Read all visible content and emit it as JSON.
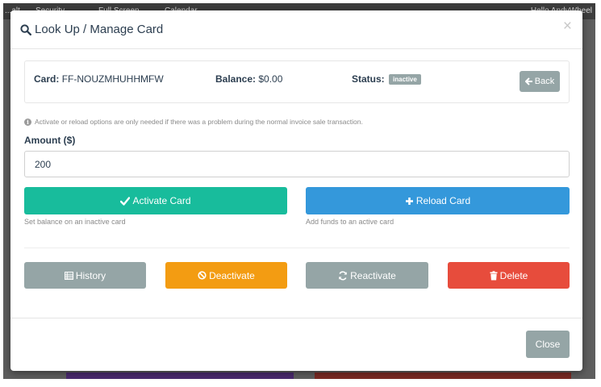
{
  "background": {
    "topbar_items": [
      "...alt",
      "Security",
      "Full Screen",
      "Calendar"
    ],
    "greeting": "Hello AndyWheel"
  },
  "modal": {
    "title": "Look Up / Manage Card",
    "close_glyph": "×",
    "card": {
      "card_label": "Card:",
      "card_value": "FF-NOUZMHUHHMFW",
      "balance_label": "Balance:",
      "balance_value": "$0.00",
      "status_label": "Status:",
      "status_value": "inactive"
    },
    "back_label": "Back",
    "note": "Activate or reload options are only needed if there was a problem during the normal invoice sale transaction.",
    "amount_label": "Amount ($)",
    "amount_value": "200",
    "activate_label": "Activate Card",
    "activate_help": "Set balance on an inactive card",
    "reload_label": "Reload Card",
    "reload_help": "Add funds to an active card",
    "history_label": "History",
    "deactivate_label": "Deactivate",
    "reactivate_label": "Reactivate",
    "delete_label": "Delete",
    "footer_close_label": "Close"
  },
  "icons": {
    "title": "search-icon",
    "back": "arrow-left-icon",
    "note": "info-circle-icon",
    "activate": "check-icon",
    "reload": "plus-icon",
    "history": "list-icon",
    "deactivate": "ban-icon",
    "reactivate": "refresh-icon",
    "delete": "trash-icon"
  },
  "colors": {
    "primary_text": "#2c3e50",
    "success": "#18bc9c",
    "info": "#3498db",
    "warning": "#f39c12",
    "danger": "#e74c3c",
    "default": "#95a5a6"
  }
}
